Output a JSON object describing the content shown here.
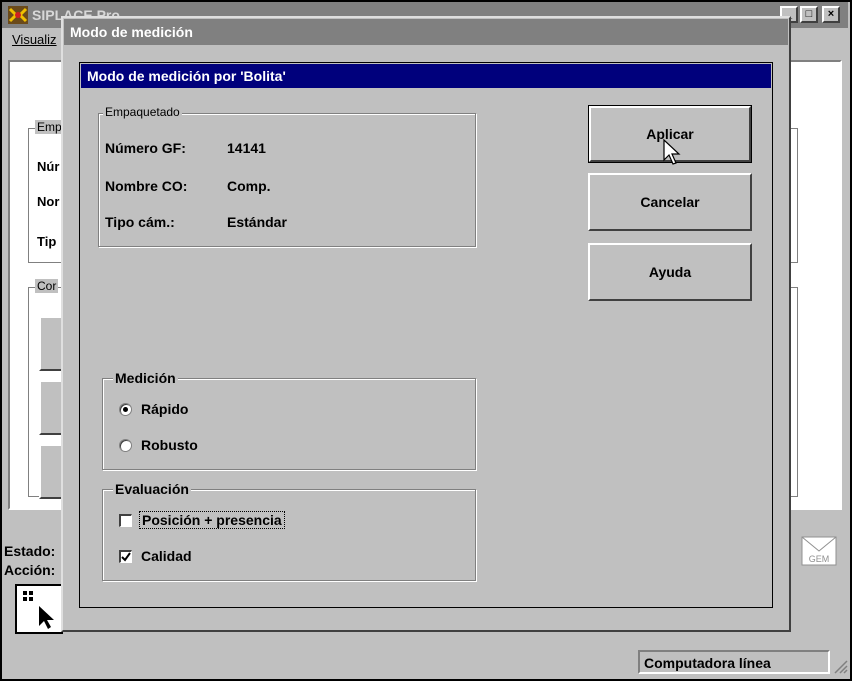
{
  "app": {
    "title": "SIPLACE Pro",
    "menu_visualizar": "Visualiz",
    "emp_legend": "Emp",
    "row_labels": [
      "Núr",
      "Nor",
      "Tip"
    ],
    "con_legend": "Cor",
    "estado_label": "Estado:",
    "accion_label": "Acción:",
    "status_text": "Computadora línea",
    "gem_label": "GEM"
  },
  "dialog": {
    "title": "Modo de medición",
    "panel_title": "Modo de medición por 'Bolita'",
    "empaquetado": {
      "legend": "Empaquetado",
      "fields": [
        {
          "label": "Número GF:",
          "value": "14141"
        },
        {
          "label": "Nombre CO:",
          "value": "Comp."
        },
        {
          "label": "Tipo cám.:",
          "value": "Estándar"
        }
      ]
    },
    "buttons": {
      "apply": "Aplicar",
      "cancel": "Cancelar",
      "help": "Ayuda"
    },
    "medicion": {
      "legend": "Medición",
      "options": [
        {
          "label": "Rápido",
          "selected": true
        },
        {
          "label": "Robusto",
          "selected": false
        }
      ]
    },
    "evaluacion": {
      "legend": "Evaluación",
      "options": [
        {
          "label": "Posición + presencia",
          "checked": false
        },
        {
          "label": "Calidad",
          "checked": true
        }
      ]
    }
  }
}
